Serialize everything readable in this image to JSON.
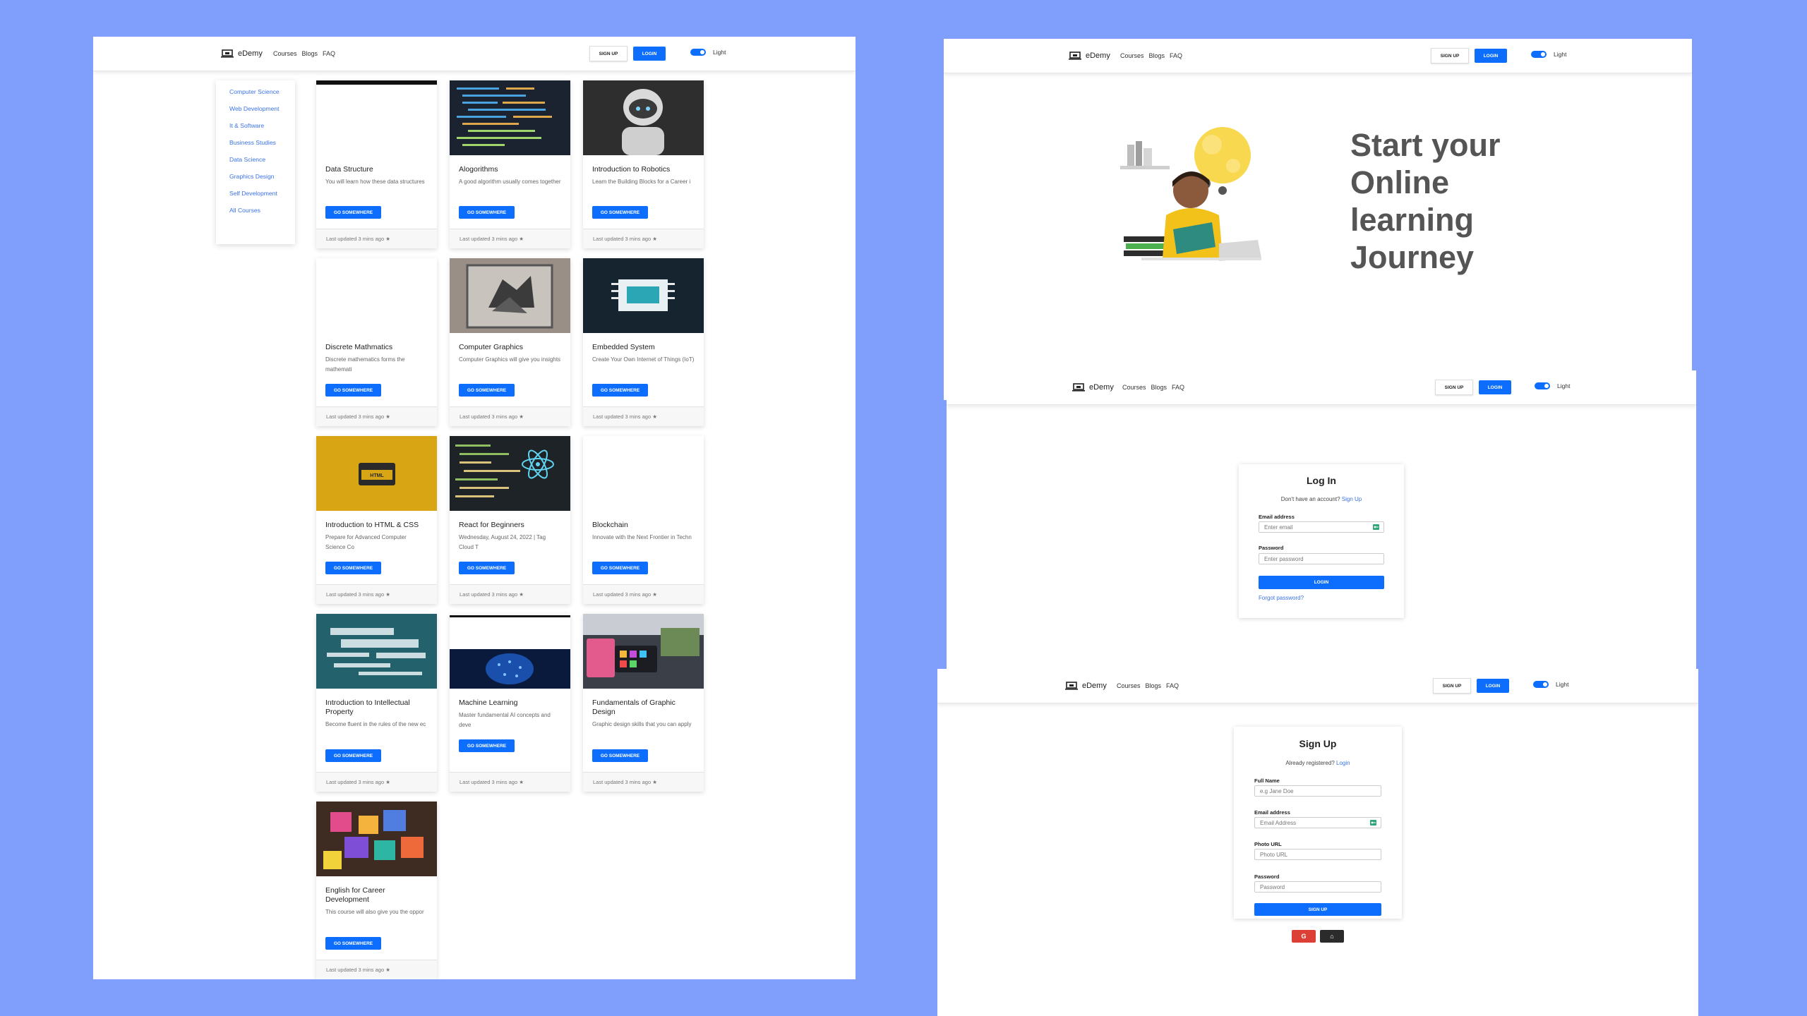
{
  "brand": {
    "name": "eDemy"
  },
  "nav": {
    "links": [
      "Courses",
      "Blogs",
      "FAQ"
    ],
    "signup": "SIGN UP",
    "login": "LOGIN",
    "theme": "Light"
  },
  "sidebar": {
    "items": [
      "Computer Science",
      "Web Development",
      "It & Software",
      "Business Studies",
      "Data Science",
      "Graphics Design",
      "Self Development",
      "All Courses"
    ]
  },
  "courses": {
    "button": "GO SOMEWHERE",
    "items": [
      {
        "title": "Data Structure",
        "desc": "You will learn how these data structures",
        "updated": "Last updated 3 mins ago ★",
        "image": "blank"
      },
      {
        "title": "Alogorithms",
        "desc": "A good algorithm usually comes together",
        "updated": "Last updated 3 mins ago ★",
        "image": "code-screen"
      },
      {
        "title": "Introduction to Robotics",
        "desc": "Learn the Building Blocks for a Career i",
        "updated": "Last updated 3 mins ago ★",
        "image": "robot"
      },
      {
        "title": "Discrete Mathmatics",
        "desc": "Discrete mathematics forms the mathemati",
        "updated": "Last updated 3 mins ago ★",
        "image": "blank"
      },
      {
        "title": "Computer Graphics",
        "desc": "Computer Graphics will give you insights",
        "updated": "Last updated 3 mins ago ★",
        "image": "3d-shape"
      },
      {
        "title": "Embedded System",
        "desc": "Create Your Own Internet of Things (IoT)",
        "updated": "Last updated 3 mins ago ★",
        "image": "circuit-board"
      },
      {
        "title": "Introduction to HTML & CSS",
        "desc": "Prepare for Advanced Computer Science Co",
        "updated": "Last updated 3 mins ago ★",
        "image": "html-window"
      },
      {
        "title": "React for Beginners",
        "desc": "Wednesday, August 24, 2022 | Tag Cloud T",
        "updated": "Last updated 3 mins ago ★",
        "image": "react-code"
      },
      {
        "title": "Blockchain",
        "desc": "Innovate with the Next Frontier in Techn",
        "updated": "Last updated 3 mins ago ★",
        "image": "blank"
      },
      {
        "title": "Introduction to Intellectual Property",
        "desc": "Become fluent in the rules of the new ec",
        "updated": "Last updated 3 mins ago ★",
        "image": "ip-wordcloud"
      },
      {
        "title": "Machine Learning",
        "desc": "Master fundamental AI concepts and deve",
        "updated": "Last updated 3 mins ago ★",
        "image": "ai-brain"
      },
      {
        "title": "Fundamentals of Graphic Design",
        "desc": "Graphic design skills that you can apply",
        "updated": "Last updated 3 mins ago ★",
        "image": "design-tablet"
      },
      {
        "title": "English for Career Development",
        "desc": "This course will also give you the oppor",
        "updated": "Last updated 3 mins ago ★",
        "image": "letter-blocks"
      }
    ]
  },
  "hero": {
    "title": "Start your Online learning Journey"
  },
  "login": {
    "title": "Log In",
    "prompt": "Don't have an account?",
    "prompt_link": "Sign Up",
    "email_label": "Email address",
    "email_placeholder": "Enter email",
    "password_label": "Password",
    "password_placeholder": "Enter password",
    "submit": "LOGIN",
    "forgot": "Forgot password?"
  },
  "signup": {
    "title": "Sign Up",
    "prompt": "Already registered?",
    "prompt_link": "Login",
    "name_label": "Full Name",
    "name_placeholder": "e.g Jane Doe",
    "email_label": "Email address",
    "email_placeholder": "Email Address",
    "photo_label": "Photo URL",
    "photo_placeholder": "Photo URL",
    "password_label": "Password",
    "password_placeholder": "Password",
    "submit": "SIGN UP",
    "google": "G",
    "github": "⌂"
  },
  "colors": {
    "background": "#809ffd",
    "primary": "#0d6efd",
    "link": "#3b72e8",
    "google": "#dc3f35",
    "github": "#2b2b2b"
  }
}
